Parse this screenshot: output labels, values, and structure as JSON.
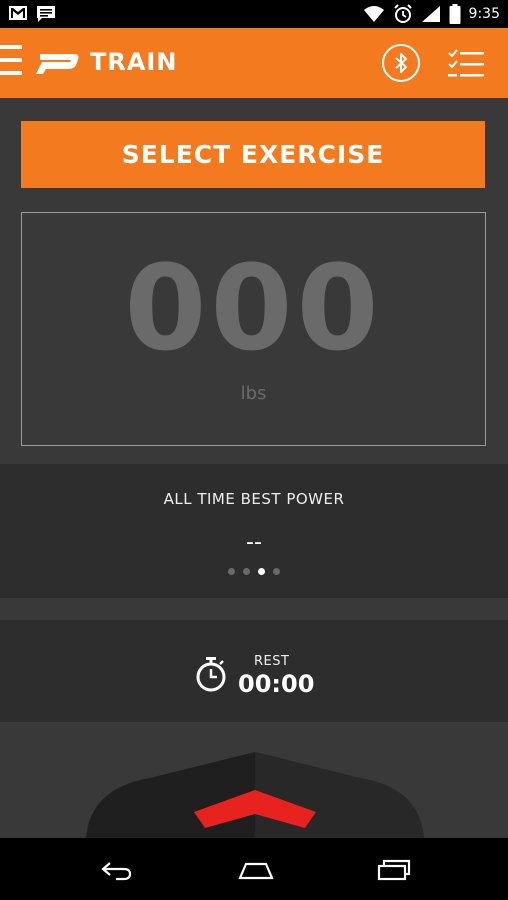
{
  "status_bar": {
    "time": "9:35"
  },
  "app_bar": {
    "title": "TRAIN"
  },
  "select_exercise": {
    "label": "SELECT EXERCISE"
  },
  "weight": {
    "value": "000",
    "unit": "lbs"
  },
  "best_power": {
    "label": "ALL TIME BEST POWER",
    "value": "--",
    "page_count": 4,
    "active_page": 3
  },
  "rest": {
    "label": "REST",
    "time": "00:00"
  },
  "colors": {
    "accent": "#f47a20",
    "background": "#3a3939",
    "panel": "#2e2d2d",
    "indicator": "#e8231f"
  },
  "icons": [
    "gmail-icon",
    "message-icon",
    "wifi-icon",
    "alarm-icon",
    "signal-icon",
    "battery-icon",
    "hamburger-icon",
    "brand-logo",
    "bluetooth-icon",
    "checklist-icon",
    "stopwatch-icon",
    "back-icon",
    "home-icon",
    "recents-icon"
  ]
}
